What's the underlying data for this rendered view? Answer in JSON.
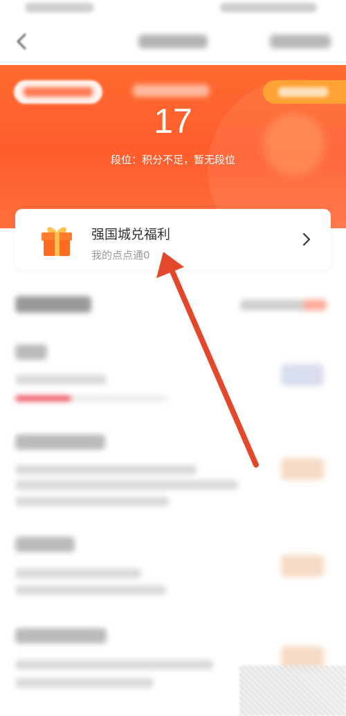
{
  "score": {
    "value": "17",
    "rank_text": "段位：积分不足，暂无段位"
  },
  "welfare_card": {
    "title": "强国城兑福利",
    "subtitle": "我的点点通0"
  },
  "progress": {
    "task1_fraction": 0.37
  },
  "colors": {
    "accent": "#ff5d2c",
    "orange_pill": "#ffa233",
    "annotation_arrow": "#e3472c",
    "progress_red": "#f04a5a"
  },
  "icons": {
    "back": "chevron-left-icon",
    "gift": "gift-icon",
    "chevron": "chevron-right-icon",
    "annotation": "annotation-arrow"
  }
}
